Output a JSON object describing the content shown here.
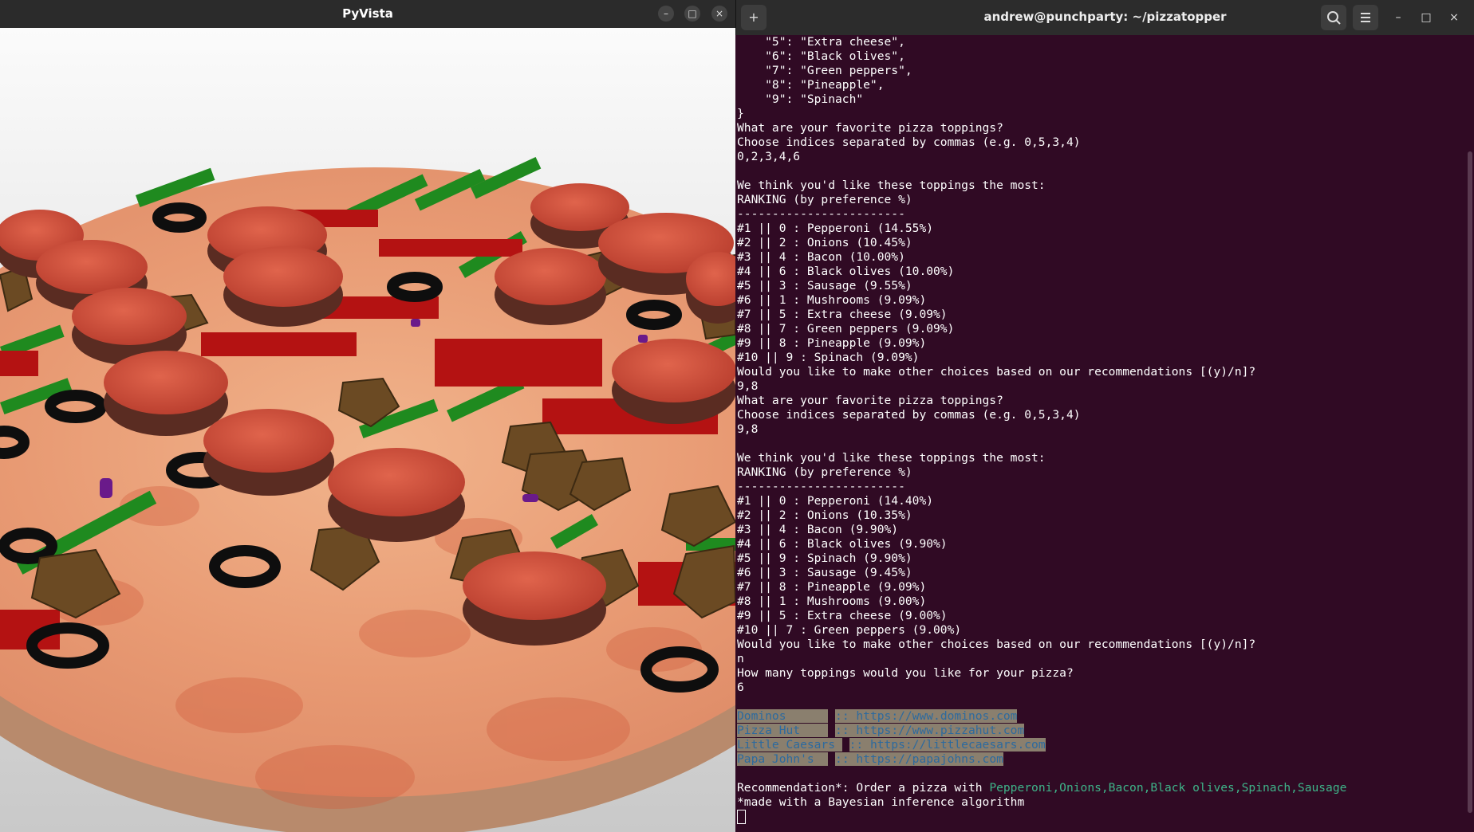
{
  "pyvista": {
    "title": "PyVista",
    "minimize": "–",
    "maximize": "□",
    "close": "×"
  },
  "terminal": {
    "title": "andrew@punchparty: ~/pizzatopper",
    "new_tab": "+",
    "search_icon": "search-icon",
    "menu_icon": "hamburger-icon",
    "minimize": "–",
    "maximize": "□",
    "close": "×",
    "lines": [
      "    \"5\": \"Extra cheese\",",
      "    \"6\": \"Black olives\",",
      "    \"7\": \"Green peppers\",",
      "    \"8\": \"Pineapple\",",
      "    \"9\": \"Spinach\"",
      "}",
      "What are your favorite pizza toppings?",
      "Choose indices separated by commas (e.g. 0,5,3,4)",
      "0,2,3,4,6",
      "",
      "We think you'd like these toppings the most:",
      "RANKING (by preference %)",
      "------------------------",
      "#1 || 0 : Pepperoni (14.55%)",
      "#2 || 2 : Onions (10.45%)",
      "#3 || 4 : Bacon (10.00%)",
      "#4 || 6 : Black olives (10.00%)",
      "#5 || 3 : Sausage (9.55%)",
      "#6 || 1 : Mushrooms (9.09%)",
      "#7 || 5 : Extra cheese (9.09%)",
      "#8 || 7 : Green peppers (9.09%)",
      "#9 || 8 : Pineapple (9.09%)",
      "#10 || 9 : Spinach (9.09%)",
      "Would you like to make other choices based on our recommendations [(y)/n]?",
      "9,8",
      "What are your favorite pizza toppings?",
      "Choose indices separated by commas (e.g. 0,5,3,4)",
      "9,8",
      "",
      "We think you'd like these toppings the most:",
      "RANKING (by preference %)",
      "------------------------",
      "#1 || 0 : Pepperoni (14.40%)",
      "#2 || 2 : Onions (10.35%)",
      "#3 || 4 : Bacon (9.90%)",
      "#4 || 6 : Black olives (9.90%)",
      "#5 || 9 : Spinach (9.90%)",
      "#6 || 3 : Sausage (9.45%)",
      "#7 || 8 : Pineapple (9.09%)",
      "#8 || 1 : Mushrooms (9.00%)",
      "#9 || 5 : Extra cheese (9.00%)",
      "#10 || 7 : Green peppers (9.00%)",
      "Would you like to make other choices based on our recommendations [(y)/n]?",
      "n",
      "How many toppings would you like for your pizza?",
      "6",
      ""
    ],
    "links": [
      {
        "name": "Dominos      ",
        "url": ":: https://www.dominos.com"
      },
      {
        "name": "Pizza Hut    ",
        "url": ":: https://www.pizzahut.com"
      },
      {
        "name": "Little Caesars ",
        "url": ":: https://littlecaesars.com"
      },
      {
        "name": "Papa John's  ",
        "url": ":: https://papajohns.com"
      }
    ],
    "rec_prefix": "Recommendation*: Order a pizza with ",
    "rec_toppings": "Pepperoni,Onions,Bacon,Black olives,Spinach,Sausage",
    "footnote": "*made with a Bayesian inference algorithm"
  },
  "colors": {
    "terminal_bg": "#300a24",
    "selection_bg": "#8a7f6e",
    "link_text": "#2d6a9e",
    "highlight_green": "#3eb489"
  }
}
